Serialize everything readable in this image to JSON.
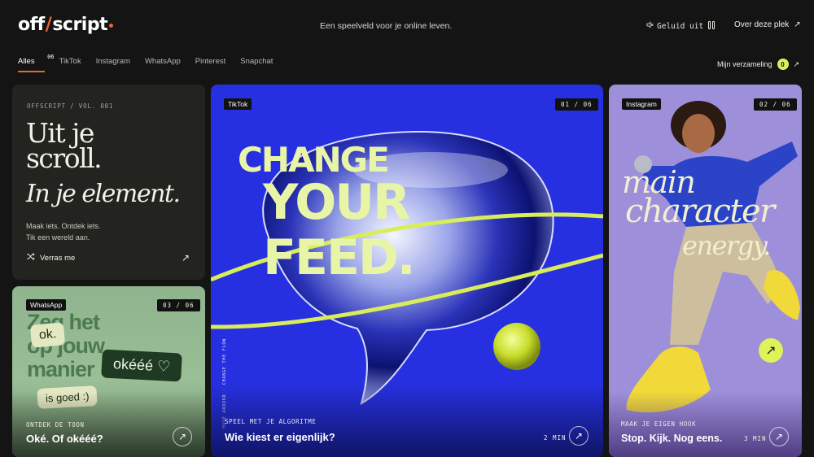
{
  "header": {
    "logo_left": "off",
    "logo_right": "script",
    "tagline": "Een speelveld voor je online leven.",
    "sound_label": "Geluid uit",
    "about_label": "Over deze plek"
  },
  "nav": {
    "tabs": [
      {
        "label": "Alles",
        "count": "06"
      },
      {
        "label": "TikTok"
      },
      {
        "label": "Instagram"
      },
      {
        "label": "WhatsApp"
      },
      {
        "label": "Pinterest"
      },
      {
        "label": "Snapchat"
      }
    ],
    "collection_label": "Mijn verzameling",
    "collection_count": "0"
  },
  "intro": {
    "volume": "OFFSCRIPT / VOL. 001",
    "headline_line1": "Uit je",
    "headline_line2": "scroll.",
    "headline_italic": "In je element.",
    "sub_line1": "Maak iets. Ontdek iets.",
    "sub_line2": "Tik een wereld aan.",
    "surprise_label": "Verras me"
  },
  "whatsapp": {
    "platform": "WhatsApp",
    "counter": "03 / 06",
    "bg_text_line1": "Zeg het",
    "bg_text_line2": "op jouw",
    "bg_text_line3": "manier",
    "bubble1": "ok.",
    "bubble2": "okééé ♡",
    "bubble3": "is goed :)",
    "kicker": "ONTDEK DE TOON",
    "title": "Oké. Of okééé?"
  },
  "tiktok": {
    "platform": "TikTok",
    "counter": "01 / 06",
    "headline_line1": "CHANGE",
    "headline_line2": "YOUR",
    "headline_line3": "FEED.",
    "vertical_text": "MOVE AROUND · CHANGE THE FLOW",
    "kicker": "SPEEL MET JE ALGORITME",
    "title": "Wie kiest er eigenlijk?",
    "duration": "2 MIN"
  },
  "instagram": {
    "platform": "Instagram",
    "counter": "02 / 06",
    "script_line1": "main",
    "script_line2": "character",
    "script_line3": "energy.",
    "kicker": "MAAK JE EIGEN HOOK",
    "title": "Stop. Kijk. Nog eens.",
    "duration": "3 MIN"
  },
  "colors": {
    "background": "#141414",
    "accent": "#e8682d",
    "lime": "#d9f25b",
    "tiktok_blue": "#2630e0",
    "instagram_lilac": "#9d8fd9",
    "whatsapp_green": "#8fb48e"
  }
}
